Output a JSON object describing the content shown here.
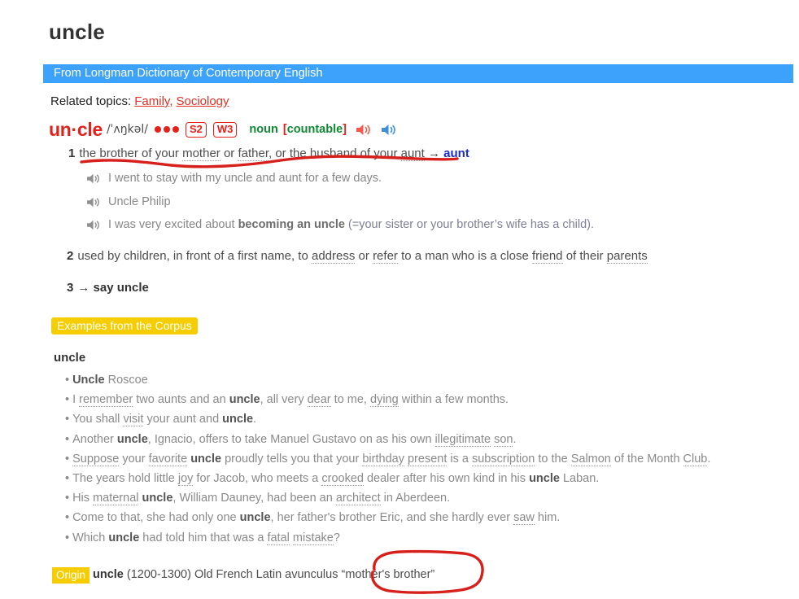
{
  "entry": {
    "title": "uncle",
    "source_bar": "From Longman Dictionary of Contemporary English",
    "related_topics_label": "Related topics:",
    "related_topics": [
      "Family",
      "Sociology"
    ],
    "headword": "un·cle",
    "ipa": "/ˈʌŋkəl/",
    "frequency_dots": 3,
    "badges": [
      "S2",
      "W3"
    ],
    "part_of_speech": "noun",
    "grammar_label_open": "[",
    "grammar_label": "countable",
    "grammar_label_close": "]",
    "speaker_british": "speaker-icon-british",
    "speaker_american": "speaker-icon-american"
  },
  "senses": [
    {
      "number": "1",
      "def_part1": "the brother of your ",
      "def_dotted1": "mother",
      "def_part2": " or ",
      "def_dotted2": "father",
      "def_part3": ", or the husband of your ",
      "def_dotted3": "aunt",
      "arrow": "→",
      "cross_reference": "aunt",
      "examples": [
        {
          "text_plain": "I went to stay with my uncle and aunt for a few days.",
          "pre": "I went to stay with my uncle and aunt for a few days.",
          "bold": "",
          "post": ""
        },
        {
          "text_plain": "Uncle Philip",
          "pre": "Uncle Philip",
          "bold": "",
          "post": ""
        },
        {
          "text_plain": "I was very excited about becoming an uncle (=your sister or your brother’s wife has a child).",
          "pre": "I was very excited about ",
          "bold": "becoming an uncle",
          "gloss": " (=your sister or your brother’s wife has a child)",
          "post": "."
        }
      ]
    },
    {
      "number": "2",
      "seg1": "used by children, in front of a first name, to ",
      "dot1": "address",
      "seg2": " or ",
      "dot2": "refer",
      "seg3": " to a man who is a close ",
      "dot3": "friend",
      "seg4": " of their ",
      "dot4": "parents",
      "examples": []
    },
    {
      "number": "3",
      "arrow": "→",
      "phrase": "say uncle",
      "examples": []
    }
  ],
  "corpus": {
    "badge": "Examples from the Corpus",
    "word": "uncle",
    "bullet": "•",
    "items": [
      [
        {
          "t": "Uncle",
          "s": "b"
        },
        {
          "t": " Roscoe",
          "s": "n"
        }
      ],
      [
        {
          "t": "I ",
          "s": "n"
        },
        {
          "t": "remember",
          "s": "d"
        },
        {
          "t": " two aunts and an ",
          "s": "n"
        },
        {
          "t": "uncle",
          "s": "b"
        },
        {
          "t": ", all very ",
          "s": "n"
        },
        {
          "t": "dear",
          "s": "d"
        },
        {
          "t": " to me, ",
          "s": "n"
        },
        {
          "t": "dying",
          "s": "d"
        },
        {
          "t": " within a few months.",
          "s": "n"
        }
      ],
      [
        {
          "t": "You shall ",
          "s": "n"
        },
        {
          "t": "visit",
          "s": "d"
        },
        {
          "t": " your aunt and ",
          "s": "n"
        },
        {
          "t": "uncle",
          "s": "b"
        },
        {
          "t": ".",
          "s": "n"
        }
      ],
      [
        {
          "t": "Another ",
          "s": "n"
        },
        {
          "t": "uncle",
          "s": "b"
        },
        {
          "t": ", Ignacio, offers to take Manuel Gustavo on as his own ",
          "s": "n"
        },
        {
          "t": "illegitimate",
          "s": "d"
        },
        {
          "t": " ",
          "s": "n"
        },
        {
          "t": "son",
          "s": "d"
        },
        {
          "t": ".",
          "s": "n"
        }
      ],
      [
        {
          "t": "Suppose",
          "s": "d"
        },
        {
          "t": " your ",
          "s": "n"
        },
        {
          "t": "favorite",
          "s": "d"
        },
        {
          "t": " ",
          "s": "n"
        },
        {
          "t": "uncle",
          "s": "b"
        },
        {
          "t": " proudly tells you that your ",
          "s": "n"
        },
        {
          "t": "birthday",
          "s": "d"
        },
        {
          "t": " ",
          "s": "n"
        },
        {
          "t": "present",
          "s": "d"
        },
        {
          "t": " is a ",
          "s": "n"
        },
        {
          "t": "subscription",
          "s": "d"
        },
        {
          "t": " to the ",
          "s": "n"
        },
        {
          "t": "Salmon",
          "s": "d"
        },
        {
          "t": " of the Month ",
          "s": "n"
        },
        {
          "t": "Club",
          "s": "d"
        },
        {
          "t": ".",
          "s": "n"
        }
      ],
      [
        {
          "t": "The years hold little ",
          "s": "n"
        },
        {
          "t": "joy",
          "s": "d"
        },
        {
          "t": " for Jacob, who meets a ",
          "s": "n"
        },
        {
          "t": "crooked",
          "s": "d"
        },
        {
          "t": " dealer after his own kind in his ",
          "s": "n"
        },
        {
          "t": "uncle",
          "s": "b"
        },
        {
          "t": " Laban.",
          "s": "n"
        }
      ],
      [
        {
          "t": "His ",
          "s": "n"
        },
        {
          "t": "maternal",
          "s": "d"
        },
        {
          "t": " ",
          "s": "n"
        },
        {
          "t": "uncle",
          "s": "b"
        },
        {
          "t": ", William Dauney, had been an ",
          "s": "n"
        },
        {
          "t": "architect",
          "s": "d"
        },
        {
          "t": " in Aberdeen.",
          "s": "n"
        }
      ],
      [
        {
          "t": "Come to that, she had only one ",
          "s": "n"
        },
        {
          "t": "uncle",
          "s": "b"
        },
        {
          "t": ", her father's brother Eric, and she hardly ever ",
          "s": "n"
        },
        {
          "t": "saw",
          "s": "d"
        },
        {
          "t": " him.",
          "s": "n"
        }
      ],
      [
        {
          "t": "Which ",
          "s": "n"
        },
        {
          "t": "uncle",
          "s": "b"
        },
        {
          "t": " had told him that was a ",
          "s": "n"
        },
        {
          "t": "fatal",
          "s": "d"
        },
        {
          "t": " ",
          "s": "n"
        },
        {
          "t": "mistake",
          "s": "d"
        },
        {
          "t": "?",
          "s": "n"
        }
      ]
    ]
  },
  "origin": {
    "badge": "Origin",
    "word": "uncle",
    "dates": "(1200-1300)",
    "languages": "Old French Latin avunculus",
    "meaning": "“mother's brother”"
  },
  "annotations": {
    "underline_sense1": "red-underline-definition-1",
    "circle_origin_meaning": "red-circle-mothers-brother"
  },
  "colors": {
    "source_bar": "#3da2fb",
    "headword_red": "#e4201a",
    "pos_green": "#0f8a32",
    "xref_blue": "#1b2ccc",
    "badge_yellow": "#f5cd00",
    "annotation_red": "#d6201c",
    "link_red": "#e03226"
  }
}
